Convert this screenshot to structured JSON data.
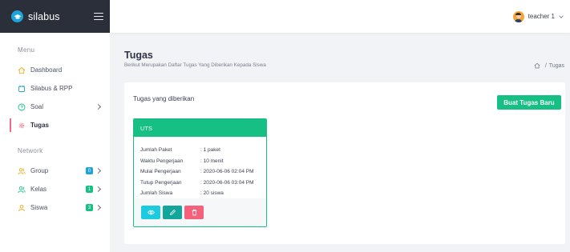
{
  "brand": {
    "name": "silabus",
    "logo_icon": "graduation-cap-icon",
    "menu_icon": "hamburger-icon"
  },
  "colors": {
    "sidebar_brand_bg": "#2b2f3a",
    "accent_green": "#16c085",
    "active_marker": "#ef6b86",
    "view": "#1ccbe0",
    "edit": "#12a59c",
    "delete": "#f5607b"
  },
  "sidebar": {
    "menu_label": "Menu",
    "network_label": "Network",
    "menu_items": [
      {
        "label": "Dashboard",
        "icon": "home-icon"
      },
      {
        "label": "Silabus & RPP",
        "icon": "document-icon"
      },
      {
        "label": "Soal",
        "icon": "question-circle-icon",
        "has_chevron": true
      },
      {
        "label": "Tugas",
        "icon": "gear-icon",
        "active": true
      }
    ],
    "network_items": [
      {
        "label": "Group",
        "icon": "users-icon",
        "badge": "0",
        "badge_color": "#1ea3dc"
      },
      {
        "label": "Kelas",
        "icon": "users-icon",
        "badge": "1",
        "badge_color": "#16c085"
      },
      {
        "label": "Siswa",
        "icon": "user-icon",
        "badge": "3",
        "badge_color": "#16c085"
      }
    ]
  },
  "topbar": {
    "user_name": "teacher 1"
  },
  "page": {
    "title": "Tugas",
    "subtitle": "Berikut Merupakan Daftar Tugas Yang Diberikan Kepada Siswa",
    "breadcrumb": {
      "separator": "/",
      "current": "Tugas"
    }
  },
  "card": {
    "title": "Tugas yang diberikan",
    "new_button": "Buat Tugas Baru",
    "task": {
      "name": "UTS",
      "fields": [
        {
          "label": "Jumlah Paket",
          "value": ": 1 paket"
        },
        {
          "label": "Waktu Pengerjaan",
          "value": ": 10 menit"
        },
        {
          "label": "Mulai Pengerjaan",
          "value": ": 2020-06-06 02:04 PM"
        },
        {
          "label": "Tutup Pengerjaan",
          "value": ": 2020-06-06 03:04 PM"
        },
        {
          "label": "Jumlah Siswa",
          "value": ": 20 siswa"
        }
      ],
      "actions": [
        "eye-icon",
        "pencil-icon",
        "trash-icon"
      ]
    }
  }
}
